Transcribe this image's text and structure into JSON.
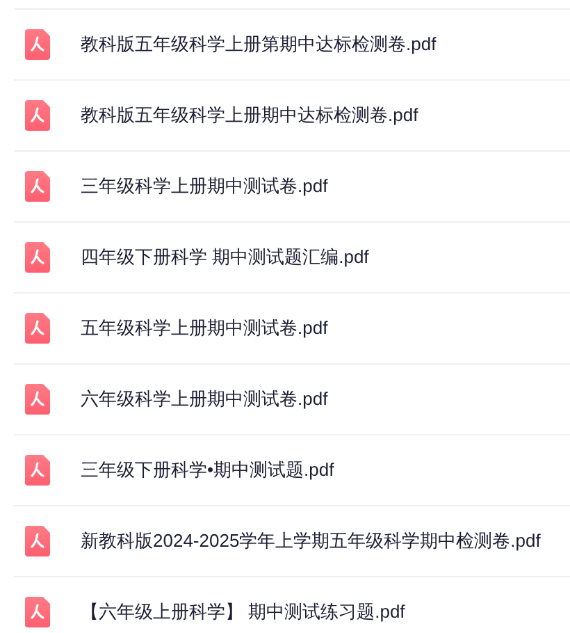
{
  "files": [
    {
      "name": "教科版五年级科学上册第期中达标检测卷.pdf"
    },
    {
      "name": "教科版五年级科学上册期中达标检测卷.pdf"
    },
    {
      "name": "三年级科学上册期中测试卷.pdf"
    },
    {
      "name": "四年级下册科学 期中测试题汇编.pdf"
    },
    {
      "name": "五年级科学上册期中测试卷.pdf"
    },
    {
      "name": "六年级科学上册期中测试卷.pdf"
    },
    {
      "name": "三年级下册科学•期中测试题.pdf"
    },
    {
      "name": "新教科版2024-2025学年上学期五年级科学期中检测卷.pdf"
    },
    {
      "name": "【六年级上册科学】 期中测试练习题.pdf"
    }
  ]
}
